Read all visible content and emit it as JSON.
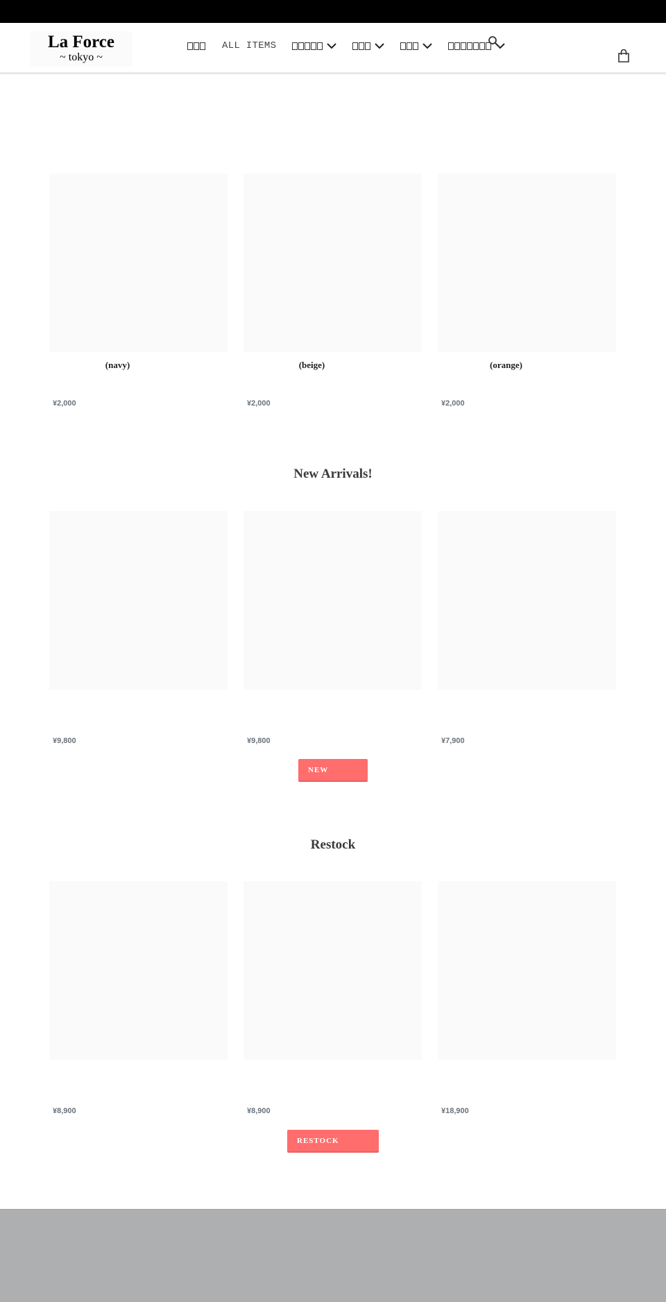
{
  "header": {
    "logo": {
      "line1": "La Force",
      "line2": "~ tokyo ~"
    },
    "nav": [
      {
        "label": "□□□",
        "tofu_count": 3,
        "active": true,
        "dropdown": false
      },
      {
        "label": "ALL ITEMS",
        "active": false,
        "dropdown": false
      },
      {
        "label": "□□□□□",
        "tofu_count": 5,
        "active": false,
        "dropdown": true
      },
      {
        "label": "□□□",
        "tofu_count": 3,
        "active": false,
        "dropdown": true
      },
      {
        "label": "□□□",
        "tofu_count": 3,
        "active": false,
        "dropdown": true
      },
      {
        "label": "□□□□□□□",
        "tofu_count": 7,
        "active": false,
        "dropdown": true
      }
    ],
    "icons": {
      "search": "search-icon",
      "cart": "cart-icon"
    }
  },
  "featured": {
    "products": [
      {
        "title": "(navy)",
        "price": "¥2,000"
      },
      {
        "title": "(beige)",
        "price": "¥2,000"
      },
      {
        "title": "(orange)",
        "price": "¥2,000"
      }
    ]
  },
  "new_arrivals": {
    "title": "New Arrivals!",
    "products": [
      {
        "title": "",
        "price": "¥9,800"
      },
      {
        "title": "",
        "price": "¥9,800"
      },
      {
        "title": "",
        "price": "¥7,900"
      }
    ],
    "button_label": "NEW"
  },
  "restock": {
    "title": "Restock",
    "products": [
      {
        "title": "",
        "price": "¥8,900"
      },
      {
        "title": "",
        "price": "¥8,900"
      },
      {
        "title": "",
        "price": "¥18,900"
      }
    ],
    "button_label": "RESTOCK"
  },
  "colors": {
    "announcement_bar": "#000000",
    "button": "#ff6d6d",
    "price": "#69727b",
    "footer": "#aeafb1",
    "image_placeholder": "#fafafa"
  }
}
